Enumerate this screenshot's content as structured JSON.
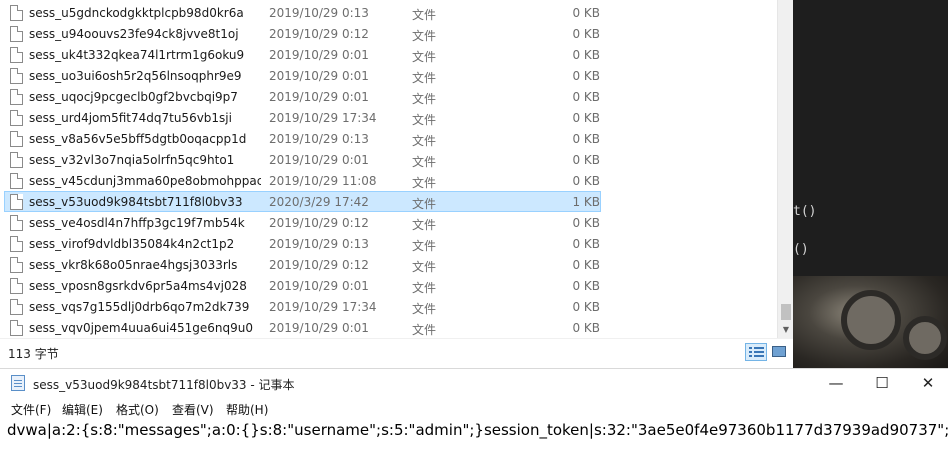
{
  "explorer": {
    "files": [
      {
        "name": "sess_u5gdnckodgkktplcpb98d0kr6a",
        "date": "2019/10/29 0:13",
        "type": "文件",
        "size": "0 KB"
      },
      {
        "name": "sess_u94oouvs23fe94ck8jvve8t1oj",
        "date": "2019/10/29 0:12",
        "type": "文件",
        "size": "0 KB"
      },
      {
        "name": "sess_uk4t332qkea74l1rtrm1g6oku9",
        "date": "2019/10/29 0:01",
        "type": "文件",
        "size": "0 KB"
      },
      {
        "name": "sess_uo3ui6osh5r2q56lnsoqphr9e9",
        "date": "2019/10/29 0:01",
        "type": "文件",
        "size": "0 KB"
      },
      {
        "name": "sess_uqocj9pcgeclb0gf2bvcbqi9p7",
        "date": "2019/10/29 0:01",
        "type": "文件",
        "size": "0 KB"
      },
      {
        "name": "sess_urd4jom5fit74dq7tu56vb1sji",
        "date": "2019/10/29 17:34",
        "type": "文件",
        "size": "0 KB"
      },
      {
        "name": "sess_v8a56v5e5bff5dgtb0oqacpp1d",
        "date": "2019/10/29 0:13",
        "type": "文件",
        "size": "0 KB"
      },
      {
        "name": "sess_v32vl3o7nqia5olrfn5qc9hto1",
        "date": "2019/10/29 0:01",
        "type": "文件",
        "size": "0 KB"
      },
      {
        "name": "sess_v45cdunj3mma60pe8obmohppac",
        "date": "2019/10/29 11:08",
        "type": "文件",
        "size": "0 KB"
      },
      {
        "name": "sess_v53uod9k984tsbt711f8l0bv33",
        "date": "2020/3/29 17:42",
        "type": "文件",
        "size": "1 KB",
        "selected": true
      },
      {
        "name": "sess_ve4osdl4n7hffp3gc19f7mb54k",
        "date": "2019/10/29 0:12",
        "type": "文件",
        "size": "0 KB"
      },
      {
        "name": "sess_virof9dvldbl35084k4n2ct1p2",
        "date": "2019/10/29 0:13",
        "type": "文件",
        "size": "0 KB"
      },
      {
        "name": "sess_vkr8k68o05nrae4hgsj3033rls",
        "date": "2019/10/29 0:12",
        "type": "文件",
        "size": "0 KB"
      },
      {
        "name": "sess_vposn8gsrkdv6pr5a4ms4vj028",
        "date": "2019/10/29 0:01",
        "type": "文件",
        "size": "0 KB"
      },
      {
        "name": "sess_vqs7g155dlj0drb6qo7m2dk739",
        "date": "2019/10/29 17:34",
        "type": "文件",
        "size": "0 KB"
      },
      {
        "name": "sess_vqv0jpem4uua6ui451ge6nq9u0",
        "date": "2019/10/29 0:01",
        "type": "文件",
        "size": "0 KB"
      }
    ],
    "status": {
      "item_count": "113 字节"
    },
    "icons": {
      "file": "file-icon",
      "details_view": "details-view-icon",
      "thumbnail_view": "thumbnail-view-icon",
      "scroll_down": "chevron-down-icon"
    }
  },
  "background_editor": {
    "line1": "t()",
    "line2": "()"
  },
  "notepad": {
    "title": "sess_v53uod9k984tsbt711f8l0bv33 - 记事本",
    "menu": [
      "文件(F)",
      "编辑(E)",
      "格式(O)",
      "查看(V)",
      "帮助(H)"
    ],
    "content": "dvwa|a:2:{s:8:\"messages\";a:0:{}s:8:\"username\";s:5:\"admin\";}session_token|s:32:\"3ae5e0f4e97360b1177d37939ad90737\";",
    "buttons": {
      "minimize": "—",
      "maximize": "☐",
      "close": "✕"
    }
  },
  "colors": {
    "selection_bg": "#cce8ff",
    "selection_border": "#99d1ff",
    "editor_bg": "#1e1e1e"
  }
}
